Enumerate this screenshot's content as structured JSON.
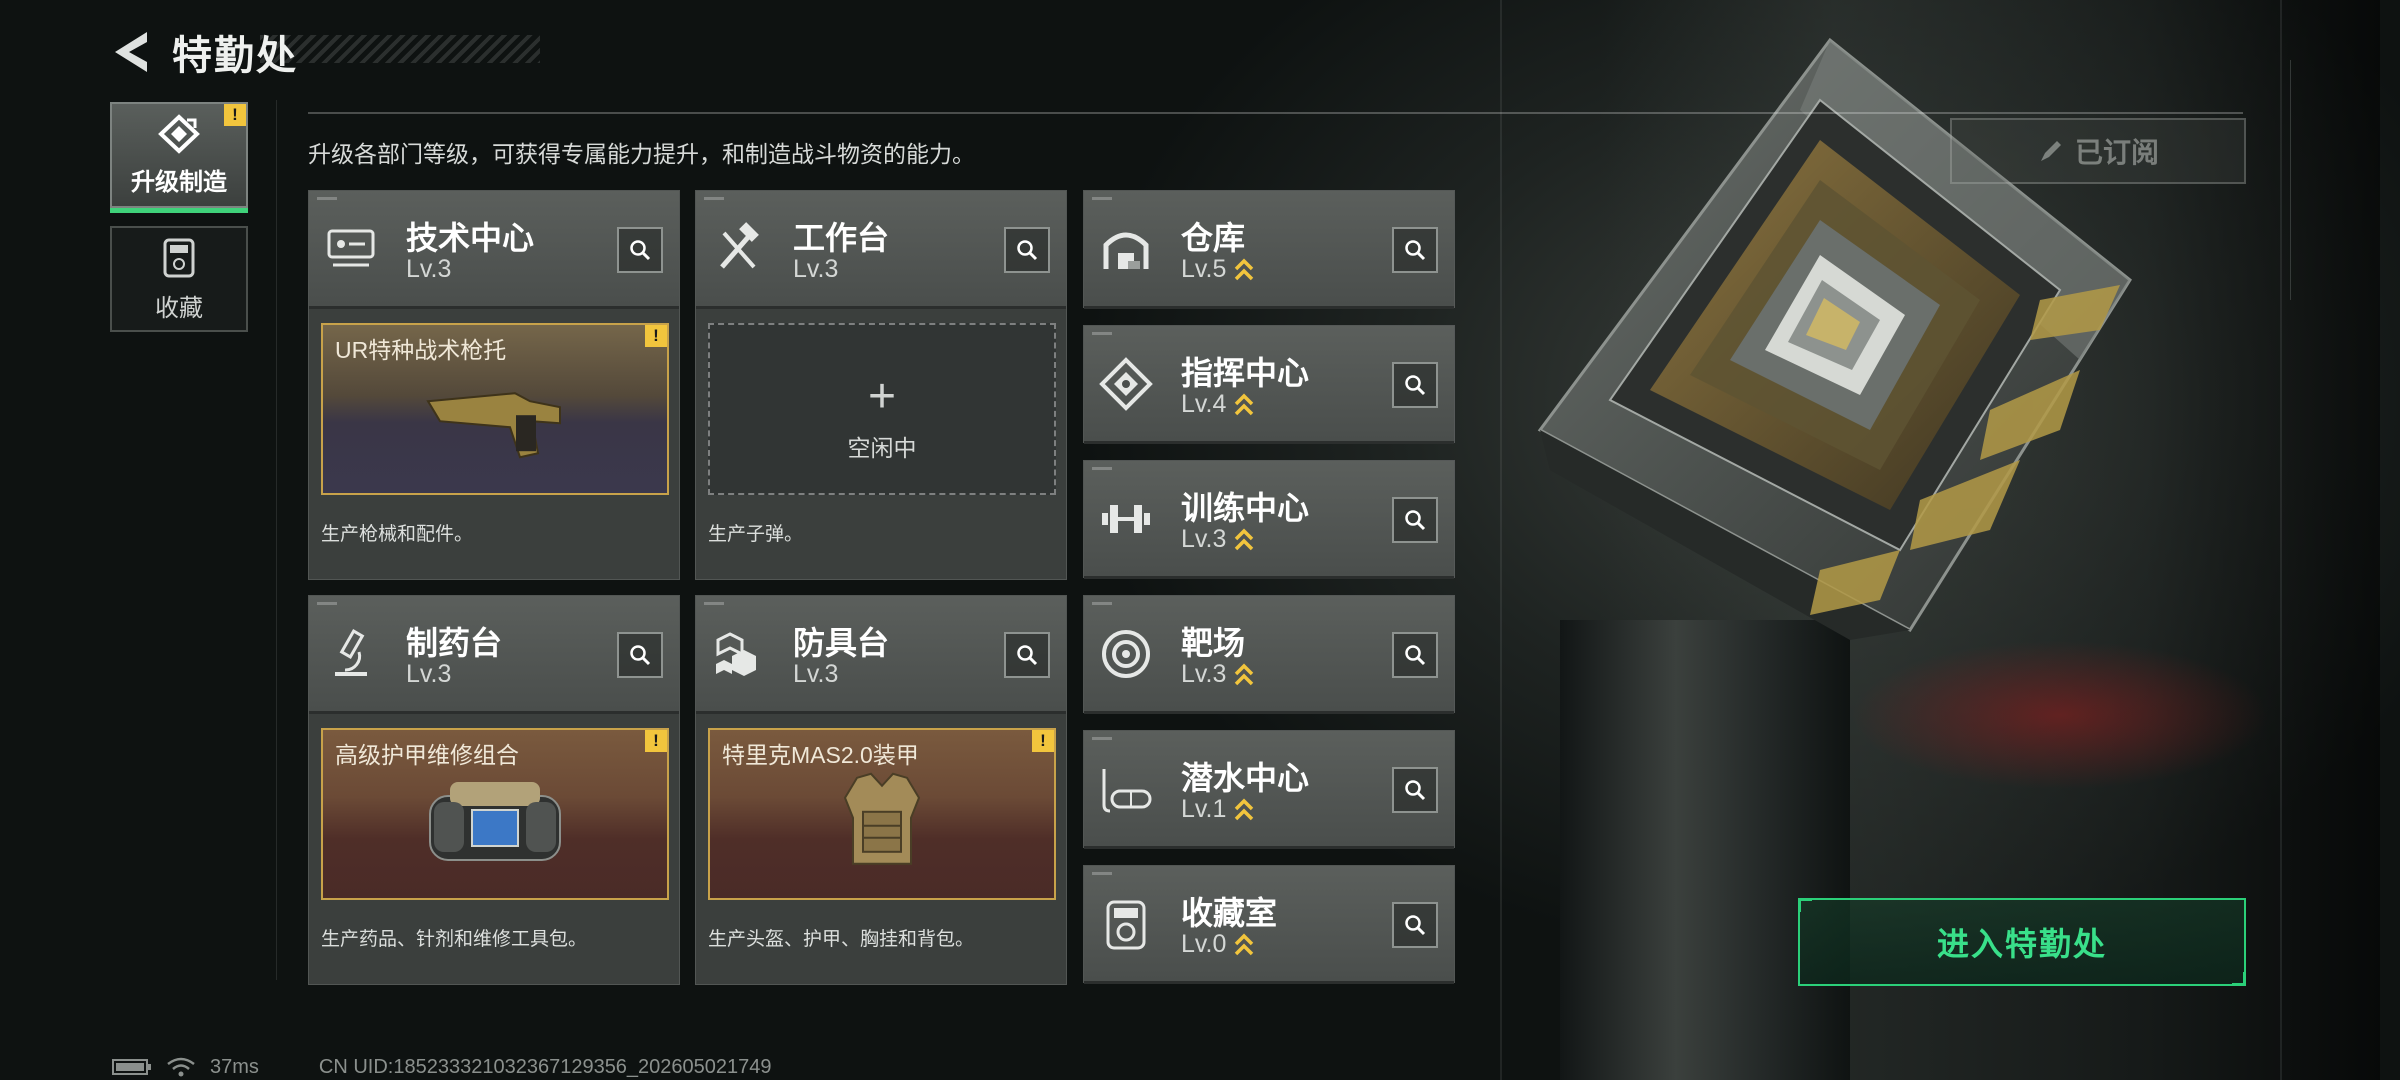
{
  "header": {
    "title": "特勤处",
    "back_icon": "back-arrow-icon"
  },
  "side_tabs": [
    {
      "label": "升级制造",
      "icon": "upgrade-craft-icon",
      "active": true,
      "alert": "!"
    },
    {
      "label": "收藏",
      "icon": "collection-icon",
      "active": false
    }
  ],
  "description": "升级各部门等级，可获得专属能力提升，和制造战斗物资的能力。",
  "big_cards": [
    {
      "name": "技术中心",
      "level": "Lv.3",
      "icon": "tech-center-icon",
      "slot": {
        "state": "item",
        "title": "UR特种战术枪托",
        "alert": "!",
        "art": "rifle-stock-art"
      },
      "desc": "生产枪械和配件。"
    },
    {
      "name": "工作台",
      "level": "Lv.3",
      "icon": "workbench-icon",
      "slot": {
        "state": "empty",
        "plus": "+",
        "idle_label": "空闲中"
      },
      "desc": "生产子弹。"
    },
    {
      "name": "制药台",
      "level": "Lv.3",
      "icon": "pharmacy-icon",
      "slot": {
        "state": "item",
        "title": "高级护甲维修组合",
        "alert": "!",
        "art": "repair-kit-art"
      },
      "desc": "生产药品、针剂和维修工具包。"
    },
    {
      "name": "防具台",
      "level": "Lv.3",
      "icon": "armor-bench-icon",
      "slot": {
        "state": "item",
        "title": "特里克MAS2.0装甲",
        "alert": "!",
        "art": "armor-vest-art"
      },
      "desc": "生产头盔、护甲、胸挂和背包。"
    }
  ],
  "small_cards": [
    {
      "name": "仓库",
      "level": "Lv.5",
      "icon": "warehouse-icon",
      "upgradable": true
    },
    {
      "name": "指挥中心",
      "level": "Lv.4",
      "icon": "command-center-icon",
      "upgradable": true
    },
    {
      "name": "训练中心",
      "level": "Lv.3",
      "icon": "training-center-icon",
      "upgradable": true
    },
    {
      "name": "靶场",
      "level": "Lv.3",
      "icon": "shooting-range-icon",
      "upgradable": true
    },
    {
      "name": "潜水中心",
      "level": "Lv.1",
      "icon": "diving-center-icon",
      "upgradable": true
    },
    {
      "name": "收藏室",
      "level": "Lv.0",
      "icon": "collection-room-icon",
      "upgradable": true
    }
  ],
  "subscribed_button": {
    "label": "已订阅",
    "icon": "pen-icon"
  },
  "enter_button": {
    "label": "进入特勤处"
  },
  "status_bar": {
    "battery_icon": "battery-icon",
    "wifi_icon": "wifi-icon",
    "ping": "37ms",
    "uid": "CN UID:18523332103236712935​6_202605021749"
  },
  "colors": {
    "accent_green": "#2bd079",
    "alert_yellow": "#f2c53d",
    "slot_border": "#c8a24a"
  }
}
